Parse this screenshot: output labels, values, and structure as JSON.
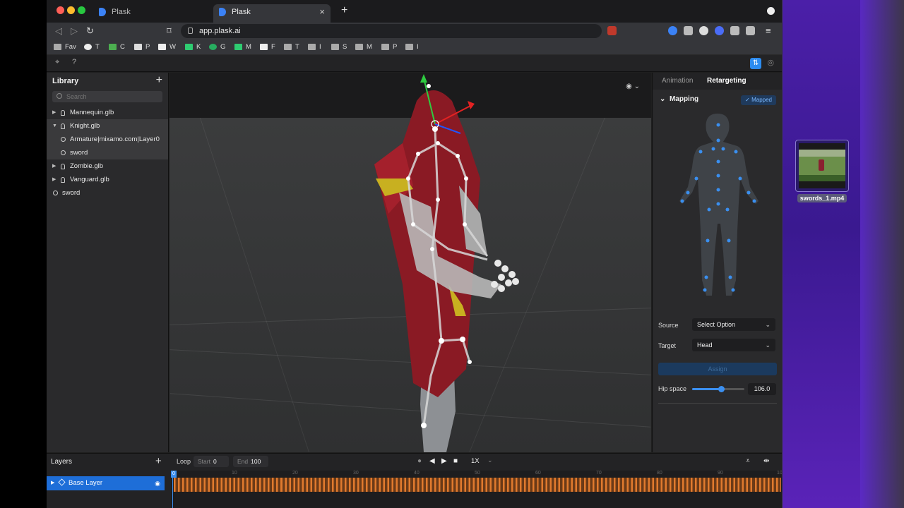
{
  "browser": {
    "tabs": [
      {
        "label": "Plask",
        "active": false
      },
      {
        "label": "Plask",
        "active": true
      }
    ],
    "url": "app.plask.ai",
    "bookmarks": [
      "Fav",
      "T",
      "C",
      "P",
      "W",
      "K",
      "G",
      "M",
      "F",
      "T",
      "I",
      "S",
      "M",
      "P",
      "I"
    ]
  },
  "desktop": {
    "file_name": "swords_1.mp4"
  },
  "library": {
    "title": "Library",
    "search_placeholder": "Search",
    "items": [
      {
        "label": "Mannequin.glb",
        "type": "model",
        "expanded": false
      },
      {
        "label": "Knight.glb",
        "type": "model",
        "expanded": true
      },
      {
        "label": "Armature|mixamo.com|Layer0",
        "type": "motion",
        "child": true
      },
      {
        "label": "sword",
        "type": "motion",
        "child": true
      },
      {
        "label": "Zombie.glb",
        "type": "model",
        "expanded": false
      },
      {
        "label": "Vanguard.glb",
        "type": "model",
        "expanded": false
      },
      {
        "label": "sword",
        "type": "motion",
        "child": false
      }
    ]
  },
  "right_panel": {
    "tabs": [
      "Animation",
      "Retargeting"
    ],
    "active_tab": "Retargeting",
    "mapping_title": "Mapping",
    "mapped_badge": "Mapped",
    "source_label": "Source",
    "source_value": "Select Option",
    "target_label": "Target",
    "target_value": "Head",
    "assign_label": "Assign",
    "hip_space_label": "Hip space",
    "hip_space_value": "106.0",
    "hip_space_fraction": 0.56
  },
  "bottom": {
    "layers_title": "Layers",
    "base_layer": "Base Layer",
    "loop_label": "Loop",
    "start_label": "Start",
    "start_value": "0",
    "end_label": "End",
    "end_value": "100",
    "speed": "1X",
    "ruler_ticks": [
      "0",
      "10",
      "20",
      "30",
      "40",
      "50",
      "60",
      "70",
      "80",
      "90",
      "10"
    ],
    "playhead_frame": "0"
  },
  "colors": {
    "accent": "#2d8cf0",
    "keyframe": "#e07a2e",
    "robe": "#8a1a24"
  },
  "icons": {
    "viewport_visibility": "eye-icon",
    "toolbar": [
      "cursor-icon",
      "help-icon"
    ]
  }
}
